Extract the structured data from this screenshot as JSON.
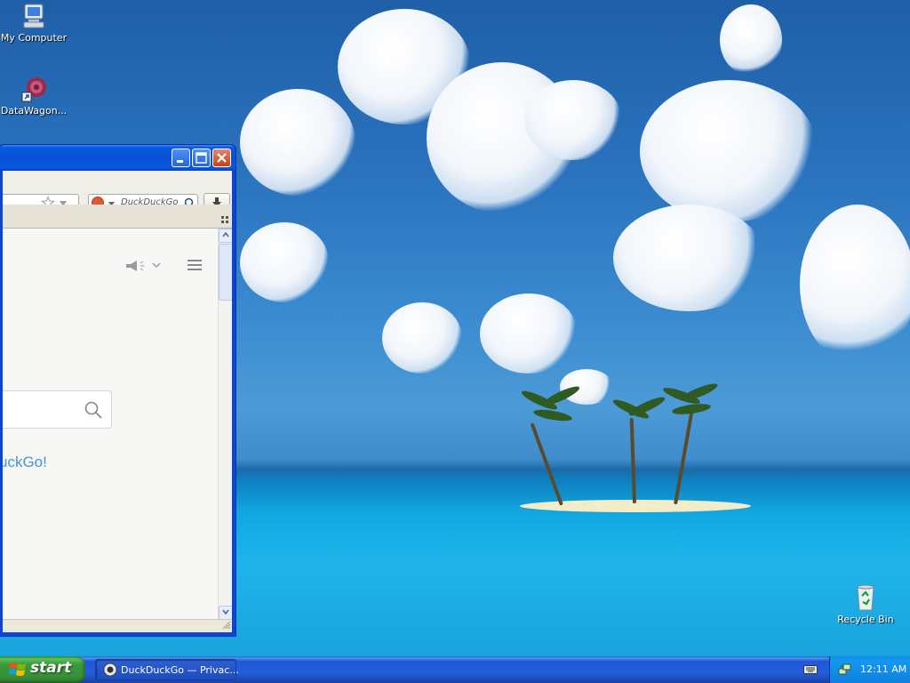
{
  "desktop": {
    "icons": [
      {
        "label": "My Computer",
        "icon": "my-computer-icon"
      },
      {
        "label": "DataWagon...",
        "icon": "datawagon-shortcut-icon"
      },
      {
        "label": "Recycle Bin",
        "icon": "recycle-bin-icon"
      }
    ]
  },
  "browser": {
    "search_engine_placeholder": "DuckDuckGo",
    "download_icon": "download-arrow-icon",
    "page": {
      "tagline_fragment": "uckGo!"
    }
  },
  "taskbar": {
    "start_label": "start",
    "task_button_label": "DuckDuckGo — Privac...",
    "clock": "12:11 AM"
  },
  "colors": {
    "title_bar": "#0450d5",
    "taskbar": "#245edb",
    "start_button": "#3c9a3c",
    "ddg_link": "#4495d4"
  }
}
